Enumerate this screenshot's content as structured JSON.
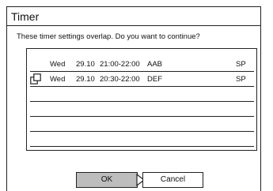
{
  "dialog": {
    "title": "Timer",
    "message": "These timer settings overlap. Do you want to continue?"
  },
  "list": {
    "rows": [
      {
        "day": "Wed",
        "date": "29.10",
        "time": "21:00-22:00",
        "name": "AAB",
        "mode": "SP",
        "icon": ""
      },
      {
        "day": "Wed",
        "date": "29.10",
        "time": "20:30-22:00",
        "name": "DEF",
        "mode": "SP",
        "icon": "overlap-icon"
      },
      {
        "day": "",
        "date": "",
        "time": "",
        "name": "",
        "mode": ""
      },
      {
        "day": "",
        "date": "",
        "time": "",
        "name": "",
        "mode": ""
      },
      {
        "day": "",
        "date": "",
        "time": "",
        "name": "",
        "mode": ""
      },
      {
        "day": "",
        "date": "",
        "time": "",
        "name": "",
        "mode": ""
      }
    ]
  },
  "buttons": {
    "ok_label": "OK",
    "cancel_label": "Cancel",
    "selected": "OK"
  },
  "colors": {
    "selected_button": "#bdbdbd",
    "border": "#222222"
  }
}
